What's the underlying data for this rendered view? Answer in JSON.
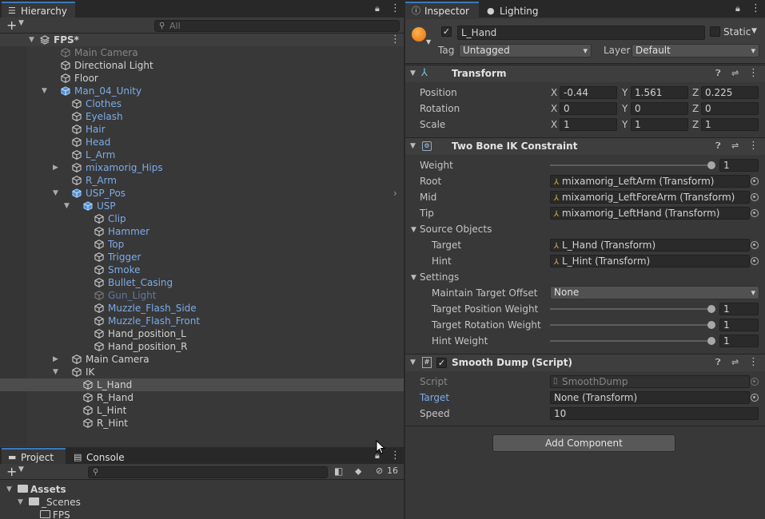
{
  "hierarchy": {
    "tab_label": "Hierarchy",
    "add_label": "+",
    "search_placeholder": "All",
    "items": [
      {
        "label": "FPS*",
        "indent": 0,
        "color": "white",
        "arrow": "down",
        "icon": "scene",
        "bold": true
      },
      {
        "label": "Main Camera",
        "indent": 1,
        "color": "dim",
        "arrow": "",
        "icon": "cube"
      },
      {
        "label": "Directional Light",
        "indent": 1,
        "color": "white",
        "arrow": "",
        "icon": "cube"
      },
      {
        "label": "Floor",
        "indent": 1,
        "color": "white",
        "arrow": "",
        "icon": "cube"
      },
      {
        "label": "Man_04_Unity",
        "indent": 1,
        "color": "blue",
        "arrow": "down",
        "icon": "prefab"
      },
      {
        "label": "Clothes",
        "indent": 2,
        "color": "blue",
        "arrow": "",
        "icon": "cube"
      },
      {
        "label": "Eyelash",
        "indent": 2,
        "color": "blue",
        "arrow": "",
        "icon": "cube"
      },
      {
        "label": "Hair",
        "indent": 2,
        "color": "blue",
        "arrow": "",
        "icon": "cube"
      },
      {
        "label": "Head",
        "indent": 2,
        "color": "blue",
        "arrow": "",
        "icon": "cube"
      },
      {
        "label": "L_Arm",
        "indent": 2,
        "color": "blue",
        "arrow": "",
        "icon": "cube"
      },
      {
        "label": "mixamorig_Hips",
        "indent": 2,
        "color": "blue",
        "arrow": "right",
        "icon": "cube"
      },
      {
        "label": "R_Arm",
        "indent": 2,
        "color": "blue",
        "arrow": "",
        "icon": "cube"
      },
      {
        "label": "USP_Pos",
        "indent": 2,
        "color": "blue",
        "arrow": "down",
        "icon": "prefab",
        "chevron": true
      },
      {
        "label": "USP",
        "indent": 3,
        "color": "blue",
        "arrow": "down",
        "icon": "prefab"
      },
      {
        "label": "Clip",
        "indent": 4,
        "color": "blue",
        "arrow": "",
        "icon": "cube"
      },
      {
        "label": "Hammer",
        "indent": 4,
        "color": "blue",
        "arrow": "",
        "icon": "cube"
      },
      {
        "label": "Top",
        "indent": 4,
        "color": "blue",
        "arrow": "",
        "icon": "cube"
      },
      {
        "label": "Trigger",
        "indent": 4,
        "color": "blue",
        "arrow": "",
        "icon": "cube"
      },
      {
        "label": "Smoke",
        "indent": 4,
        "color": "blue",
        "arrow": "",
        "icon": "cube"
      },
      {
        "label": "Bullet_Casing",
        "indent": 4,
        "color": "blue",
        "arrow": "",
        "icon": "cube"
      },
      {
        "label": "Gun_Light",
        "indent": 4,
        "color": "dimblue",
        "arrow": "",
        "icon": "cube"
      },
      {
        "label": "Muzzle_Flash_Side",
        "indent": 4,
        "color": "blue",
        "arrow": "",
        "icon": "cube"
      },
      {
        "label": "Muzzle_Flash_Front",
        "indent": 4,
        "color": "blue",
        "arrow": "",
        "icon": "cube"
      },
      {
        "label": "Hand_position_L",
        "indent": 4,
        "color": "white",
        "arrow": "",
        "icon": "cube"
      },
      {
        "label": "Hand_position_R",
        "indent": 4,
        "color": "white",
        "arrow": "",
        "icon": "cube"
      },
      {
        "label": "Main Camera",
        "indent": 2,
        "color": "white",
        "arrow": "right",
        "icon": "cube"
      },
      {
        "label": "IK",
        "indent": 2,
        "color": "white",
        "arrow": "down",
        "icon": "cube"
      },
      {
        "label": "L_Hand",
        "indent": 3,
        "color": "white",
        "arrow": "",
        "icon": "cube",
        "selected": true
      },
      {
        "label": "R_Hand",
        "indent": 3,
        "color": "white",
        "arrow": "",
        "icon": "cube"
      },
      {
        "label": "L_Hint",
        "indent": 3,
        "color": "white",
        "arrow": "",
        "icon": "cube"
      },
      {
        "label": "R_Hint",
        "indent": 3,
        "color": "white",
        "arrow": "",
        "icon": "cube"
      }
    ]
  },
  "project": {
    "tab_project": "Project",
    "tab_console": "Console",
    "add_label": "+",
    "hidden_count": "16",
    "tree": [
      {
        "label": "Assets",
        "indent": 0,
        "bold": true
      },
      {
        "label": "_Scenes",
        "indent": 1,
        "bold": false
      },
      {
        "label": "FPS",
        "indent": 2,
        "bold": false
      }
    ]
  },
  "inspector": {
    "tab_inspector": "Inspector",
    "tab_lighting": "Lighting",
    "object_name": "L_Hand",
    "static_label": "Static",
    "tag_label": "Tag",
    "tag_value": "Untagged",
    "layer_label": "Layer",
    "layer_value": "Default",
    "transform": {
      "title": "Transform",
      "position_label": "Position",
      "rotation_label": "Rotation",
      "scale_label": "Scale",
      "position": {
        "x": "-0.44",
        "y": "1.561",
        "z": "0.225"
      },
      "rotation": {
        "x": "0",
        "y": "0",
        "z": "0"
      },
      "scale": {
        "x": "1",
        "y": "1",
        "z": "1"
      },
      "axis_x": "X",
      "axis_y": "Y",
      "axis_z": "Z"
    },
    "ik": {
      "title": "Two Bone IK Constraint",
      "weight_label": "Weight",
      "weight_value": "1",
      "root_label": "Root",
      "root_value": "mixamorig_LeftArm (Transform)",
      "mid_label": "Mid",
      "mid_value": "mixamorig_LeftForeArm (Transform)",
      "tip_label": "Tip",
      "tip_value": "mixamorig_LeftHand (Transform)",
      "source_label": "Source Objects",
      "target_label": "Target",
      "target_value": "L_Hand (Transform)",
      "hint_label": "Hint",
      "hint_value": "L_Hint (Transform)",
      "settings_label": "Settings",
      "maintain_label": "Maintain Target Offset",
      "maintain_value": "None",
      "tpw_label": "Target Position Weight",
      "tpw_value": "1",
      "trw_label": "Target Rotation Weight",
      "trw_value": "1",
      "hw_label": "Hint Weight",
      "hw_value": "1"
    },
    "script": {
      "title": "Smooth Dump (Script)",
      "script_label": "Script",
      "script_value": "SmoothDump",
      "target_label": "Target",
      "target_value": "None (Transform)",
      "speed_label": "Speed",
      "speed_value": "10"
    },
    "add_component_label": "Add Component"
  }
}
